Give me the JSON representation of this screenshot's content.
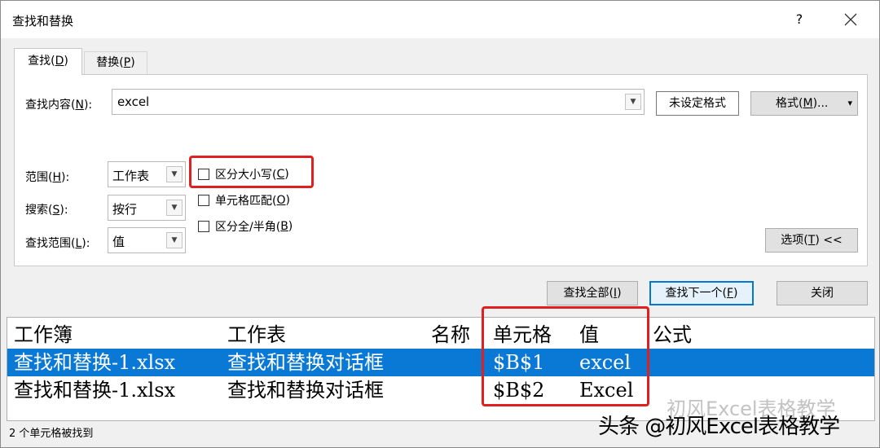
{
  "window": {
    "title": "查找和替换",
    "help": "?",
    "close": "✕"
  },
  "tabs": [
    {
      "label": "查找(",
      "key": "D",
      "suffix": ")"
    },
    {
      "label": "替换(",
      "key": "P",
      "suffix": ")"
    }
  ],
  "find": {
    "label": "查找内容(",
    "key": "N",
    "suffix": "):",
    "value": "excel",
    "format_status": "未设定格式",
    "format_button": "格式(",
    "format_key": "M",
    "format_suffix": ")...",
    "format_arrow": "▾"
  },
  "options": {
    "scope": {
      "label": "范围(",
      "key": "H",
      "suffix": "):",
      "value": "工作表"
    },
    "search": {
      "label": "搜索(",
      "key": "S",
      "suffix": "):",
      "value": "按行"
    },
    "lookin": {
      "label": "查找范围(",
      "key": "L",
      "suffix": "):",
      "value": "值"
    },
    "match_case": {
      "label": "区分大小写(",
      "key": "C",
      "suffix": ")",
      "checked": false
    },
    "match_cell": {
      "label": "单元格匹配(",
      "key": "O",
      "suffix": ")",
      "checked": false
    },
    "match_byte": {
      "label": "区分全/半角(",
      "key": "B",
      "suffix": ")",
      "checked": false
    },
    "options_button": "选项(",
    "options_key": "T",
    "options_suffix": ") <<"
  },
  "actions": {
    "find_all": "查找全部(",
    "find_all_key": "I",
    "find_all_suffix": ")",
    "find_next": "查找下一个(",
    "find_next_key": "F",
    "find_next_suffix": ")",
    "close": "关闭"
  },
  "results": {
    "columns": [
      "工作簿",
      "工作表",
      "名称",
      "单元格",
      "值",
      "公式"
    ],
    "rows": [
      [
        "查找和替换-1.xlsx",
        "查找和替换对话框",
        "",
        "$B$1",
        "excel",
        ""
      ],
      [
        "查找和替换-1.xlsx",
        "查找和替换对话框",
        "",
        "$B$2",
        "Excel",
        ""
      ]
    ]
  },
  "status": "2 个单元格被找到",
  "watermark": {
    "main": "头条 @初风Excel表格教学",
    "faded": "初风Excel表格教学"
  },
  "colors": {
    "accent": "#0a79d6",
    "highlight": "#e02020"
  },
  "icons": {
    "dropdown": "▾"
  }
}
